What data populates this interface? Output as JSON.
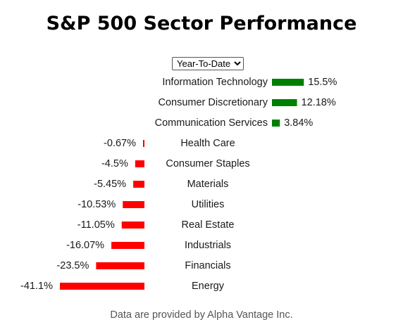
{
  "title": "S&P 500 Sector Performance",
  "range_select": {
    "selected": "Year-To-Date"
  },
  "footer": "Data are provided by Alpha Vantage Inc.",
  "colors": {
    "positive": "#008000",
    "negative": "#ff0000"
  },
  "chart_data": {
    "type": "bar",
    "orientation": "horizontal",
    "title": "S&P 500 Sector Performance",
    "xlabel": "",
    "ylabel": "",
    "grid": false,
    "categories": [
      "Information Technology",
      "Consumer Discretionary",
      "Communication Services",
      "Health Care",
      "Consumer Staples",
      "Materials",
      "Utilities",
      "Real Estate",
      "Industrials",
      "Financials",
      "Energy"
    ],
    "values": [
      15.5,
      12.18,
      3.84,
      -0.67,
      -4.5,
      -5.45,
      -10.53,
      -11.05,
      -16.07,
      -23.5,
      -41.1
    ],
    "labels": [
      "15.5%",
      "12.18%",
      "3.84%",
      "-0.67%",
      "-4.5%",
      "-5.45%",
      "-10.53%",
      "-11.05%",
      "-16.07%",
      "-23.5%",
      "-41.1%"
    ]
  }
}
